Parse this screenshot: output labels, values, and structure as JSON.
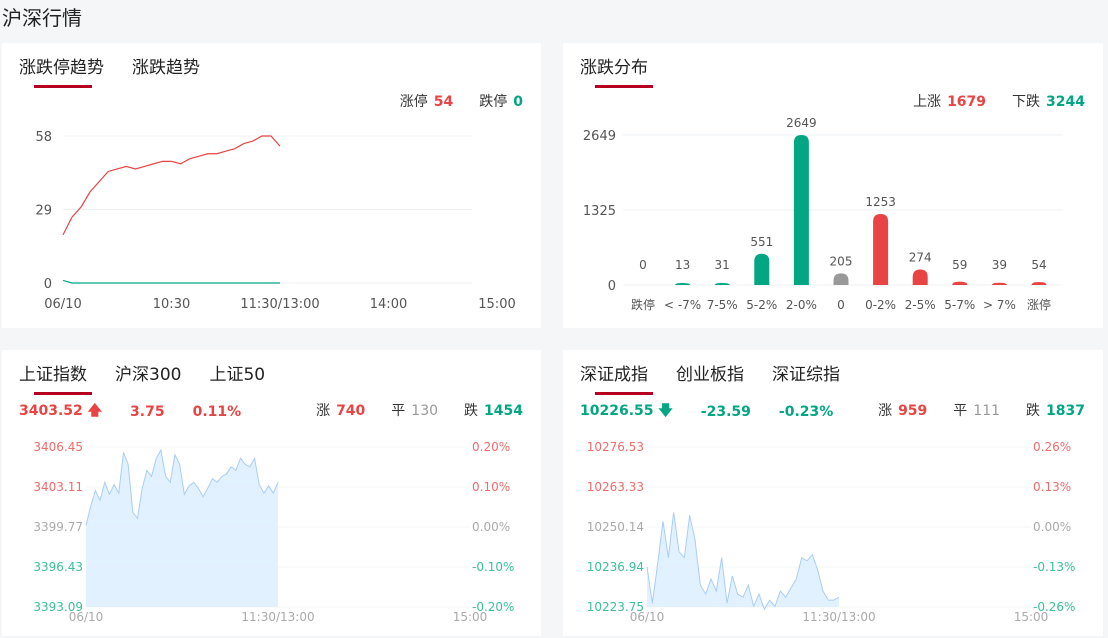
{
  "page_title": "沪深行情",
  "limit_panel": {
    "tabs": [
      "涨跌停趋势",
      "涨跌趋势"
    ],
    "up_label": "涨停",
    "up_value": "54",
    "down_label": "跌停",
    "down_value": "0"
  },
  "dist_panel": {
    "tabs": [
      "涨跌分布"
    ],
    "up_label": "上涨",
    "up_value": "1679",
    "down_label": "下跌",
    "down_value": "3244"
  },
  "sh_panel": {
    "tabs": [
      "上证指数",
      "沪深300",
      "上证50"
    ],
    "price": "3403.52",
    "change": "3.75",
    "pct": "0.11%",
    "rise_label": "涨",
    "rise": "740",
    "flat_label": "平",
    "flat": "130",
    "fall_label": "跌",
    "fall": "1454"
  },
  "sz_panel": {
    "tabs": [
      "深证成指",
      "创业板指",
      "深证综指"
    ],
    "price": "10226.55",
    "change": "-23.59",
    "pct": "-0.23%",
    "rise_label": "涨",
    "rise": "959",
    "flat_label": "平",
    "flat": "111",
    "fall_label": "跌",
    "fall": "1837"
  },
  "colors": {
    "red": "#e84444",
    "green": "#02a683",
    "gray": "#999999",
    "area": "#ddeeff",
    "area_line": "#a9cdf5"
  },
  "chart_data": [
    {
      "type": "line",
      "name": "limit-trend",
      "yticks": [
        "58",
        "29",
        "0"
      ],
      "ylim": [
        0,
        58
      ],
      "xticks": [
        "06/10",
        "10:30",
        "11:30/13:00",
        "14:00",
        "15:00"
      ],
      "x_minutes_total": 240,
      "step_minutes": 5,
      "series": [
        {
          "name": "涨停",
          "color": "#e84444",
          "values": [
            19,
            26,
            30,
            36,
            40,
            44,
            45,
            46,
            45,
            46,
            47,
            48,
            48,
            47,
            49,
            50,
            51,
            51,
            52,
            53,
            55,
            56,
            58,
            58,
            54
          ]
        },
        {
          "name": "跌停",
          "color": "#02a683",
          "values": [
            1,
            0,
            0,
            0,
            0,
            0,
            0,
            0,
            0,
            0,
            0,
            0,
            0,
            0,
            0,
            0,
            0,
            0,
            0,
            0,
            0,
            0,
            0,
            0,
            0
          ]
        }
      ]
    },
    {
      "type": "bar",
      "name": "distribution",
      "yticks": [
        "2649",
        "1325",
        "0"
      ],
      "ylim": [
        0,
        2649
      ],
      "categories": [
        "跌停",
        "< -7%",
        "7-5%",
        "5-2%",
        "2-0%",
        "0",
        "0-2%",
        "2-5%",
        "5-7%",
        "> 7%",
        "涨停"
      ],
      "values": [
        0,
        13,
        31,
        551,
        2649,
        205,
        1253,
        274,
        59,
        39,
        54
      ],
      "colors": [
        "#02a683",
        "#02a683",
        "#02a683",
        "#02a683",
        "#02a683",
        "#999999",
        "#e84444",
        "#e84444",
        "#e84444",
        "#e84444",
        "#e84444"
      ]
    },
    {
      "type": "area",
      "name": "sh-index",
      "yticks": [
        "3406.45",
        "3403.11",
        "3399.77",
        "3396.43",
        "3393.09"
      ],
      "ylim": [
        3393.09,
        3406.45
      ],
      "rticks": [
        "0.20%",
        "0.10%",
        "0.00%",
        "-0.10%",
        "-0.20%"
      ],
      "xticks": [
        "06/10",
        "11:30/13:00",
        "15:00"
      ],
      "x_minutes_total": 240,
      "values": [
        3399.9,
        3401.5,
        3402.8,
        3402,
        3403.5,
        3402.5,
        3403.3,
        3402.6,
        3406,
        3405,
        3401,
        3400.5,
        3403,
        3404.5,
        3404,
        3405.5,
        3406.2,
        3404,
        3403.5,
        3405.8,
        3405,
        3402.5,
        3403.2,
        3403.5,
        3403,
        3402.3,
        3403,
        3403.8,
        3403.5,
        3404,
        3404.2,
        3404.8,
        3404.5,
        3405.5,
        3405,
        3404.8,
        3405.5,
        3403.3,
        3402.6,
        3403.2,
        3402.6,
        3403.5
      ]
    },
    {
      "type": "area",
      "name": "sz-index",
      "yticks": [
        "10276.53",
        "10263.33",
        "10250.14",
        "10236.94",
        "10223.75"
      ],
      "ylim": [
        10223.75,
        10276.53
      ],
      "rticks": [
        "0.26%",
        "0.13%",
        "0.00%",
        "-0.13%",
        "-0.26%"
      ],
      "xticks": [
        "06/10",
        "11:30/13:00",
        "15:00"
      ],
      "x_minutes_total": 240,
      "values": [
        10237,
        10225,
        10238,
        10252,
        10240,
        10255,
        10242,
        10240,
        10254,
        10246,
        10231,
        10228,
        10233,
        10229,
        10240,
        10225,
        10234,
        10228,
        10227,
        10231,
        10224,
        10228,
        10223,
        10226,
        10224,
        10229,
        10227,
        10230,
        10233,
        10240,
        10239,
        10241,
        10236,
        10229,
        10226,
        10226,
        10227
      ]
    }
  ]
}
